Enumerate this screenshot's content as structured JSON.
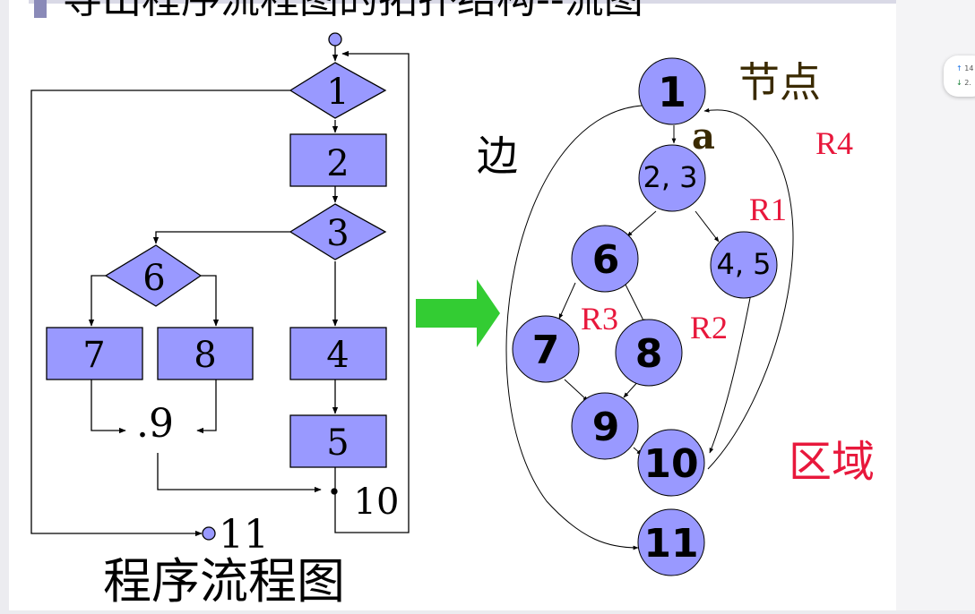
{
  "title": "导出程序流程图的拓扑结构--流图",
  "flowchart": {
    "caption": "程序流程图",
    "nodes": [
      "1",
      "2",
      "3",
      "6",
      "7",
      "8",
      ".9",
      "4",
      "5",
      "10",
      "11"
    ]
  },
  "flowgraph": {
    "nodes": [
      "1",
      "2, 3",
      "6",
      "4, 5",
      "7",
      "8",
      "9",
      "10",
      "11"
    ],
    "label_node": "节点",
    "label_edge": "边",
    "label_edge_a": "a",
    "label_region": "区域",
    "regions": [
      "R1",
      "R2",
      "R3",
      "R4"
    ]
  },
  "colors": {
    "node_fill": "#9999ff",
    "arrow": "#33cc33",
    "region_text": "#e8183c",
    "label_text": "#3a2a00"
  },
  "status_widget": {
    "up": "14",
    "down": "2."
  }
}
